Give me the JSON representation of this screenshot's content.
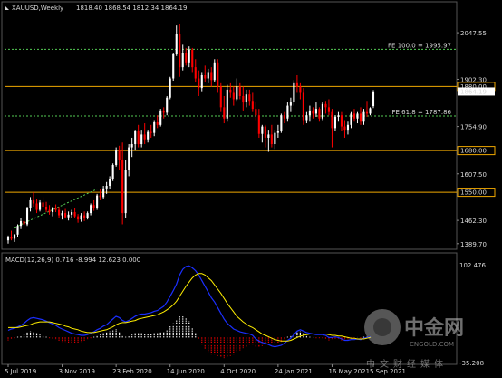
{
  "header": {
    "symbol": "XAUUSD,Weekly",
    "ohlc": "1818.40 1868.54 1812.34 1864.19"
  },
  "macd_header": "MACD(12,26,9) 0.716 -8.994 12.623 0.000",
  "colors": {
    "background": "#000000",
    "bull": "#ffffff",
    "bear": "#ff0000",
    "macd_line": "#1b2fff",
    "signal_line": "#ffee00",
    "hist_pos": "#ffffff",
    "hist_neg": "#ff0000",
    "hline": "#f0a800",
    "fib": "#55cc55",
    "price_box": "#ffffff"
  },
  "watermark": {
    "name": "中金网",
    "domain": "CNGOLD.COM",
    "slogan": "中文财经媒体"
  },
  "chart_data": {
    "type": "candlestick",
    "price_panel": {
      "ylim": [
        1375,
        2110
      ],
      "y_ticks": [
        "2047.55",
        "1902.30",
        "1754.90",
        "1607.50",
        "1462.30",
        "1389.70"
      ],
      "levels": [
        {
          "label": "1880.00",
          "value": 1880,
          "kind": "horizontal"
        },
        {
          "label": "1680.00",
          "value": 1680,
          "kind": "horizontal"
        },
        {
          "label": "1550.00",
          "value": 1550,
          "kind": "horizontal"
        },
        {
          "label": "FE 100.0 = 1995.97",
          "value": 1995.97,
          "kind": "fib"
        },
        {
          "label": "FE 61.8 = 1787.86",
          "value": 1787.86,
          "kind": "fib"
        }
      ],
      "current_price": {
        "label": "1864.19",
        "value": 1864.19
      }
    },
    "macd_panel": {
      "ylim": [
        -35.208,
        102.476
      ],
      "y_ticks": [
        "102.476",
        "-35.208"
      ]
    },
    "x_ticks": [
      "5 Jul 2019",
      "3 Nov 2019",
      "23 Feb 2020",
      "14 Jun 2020",
      "4 Oct 2020",
      "24 Jan 2021",
      "16 May 2021",
      "5 Sep 2021"
    ],
    "candles": [
      [
        1400,
        1415,
        1390,
        1410
      ],
      [
        1410,
        1430,
        1400,
        1405
      ],
      [
        1405,
        1420,
        1395,
        1418
      ],
      [
        1418,
        1450,
        1410,
        1445
      ],
      [
        1445,
        1470,
        1435,
        1460
      ],
      [
        1460,
        1475,
        1440,
        1450
      ],
      [
        1450,
        1505,
        1445,
        1500
      ],
      [
        1500,
        1535,
        1490,
        1525
      ],
      [
        1525,
        1550,
        1505,
        1515
      ],
      [
        1515,
        1530,
        1485,
        1495
      ],
      [
        1495,
        1525,
        1490,
        1518
      ],
      [
        1518,
        1535,
        1500,
        1505
      ],
      [
        1505,
        1520,
        1488,
        1495
      ],
      [
        1495,
        1510,
        1480,
        1488
      ],
      [
        1488,
        1505,
        1475,
        1500
      ],
      [
        1500,
        1512,
        1488,
        1495
      ],
      [
        1495,
        1505,
        1470,
        1478
      ],
      [
        1478,
        1492,
        1465,
        1485
      ],
      [
        1485,
        1498,
        1468,
        1472
      ],
      [
        1472,
        1490,
        1462,
        1480
      ],
      [
        1480,
        1495,
        1470,
        1488
      ],
      [
        1488,
        1500,
        1470,
        1475
      ],
      [
        1475,
        1482,
        1455,
        1465
      ],
      [
        1465,
        1485,
        1458,
        1478
      ],
      [
        1478,
        1490,
        1460,
        1470
      ],
      [
        1470,
        1490,
        1465,
        1485
      ],
      [
        1485,
        1515,
        1478,
        1510
      ],
      [
        1510,
        1525,
        1492,
        1500
      ],
      [
        1500,
        1545,
        1495,
        1540
      ],
      [
        1540,
        1560,
        1525,
        1535
      ],
      [
        1535,
        1570,
        1528,
        1562
      ],
      [
        1562,
        1582,
        1545,
        1570
      ],
      [
        1570,
        1600,
        1560,
        1590
      ],
      [
        1590,
        1640,
        1585,
        1635
      ],
      [
        1635,
        1690,
        1630,
        1680
      ],
      [
        1680,
        1695,
        1620,
        1650
      ],
      [
        1650,
        1705,
        1450,
        1485
      ],
      [
        1485,
        1650,
        1470,
        1620
      ],
      [
        1620,
        1700,
        1600,
        1690
      ],
      [
        1690,
        1720,
        1660,
        1700
      ],
      [
        1700,
        1745,
        1680,
        1740
      ],
      [
        1740,
        1760,
        1690,
        1700
      ],
      [
        1700,
        1745,
        1690,
        1730
      ],
      [
        1730,
        1765,
        1700,
        1715
      ],
      [
        1715,
        1745,
        1705,
        1738
      ],
      [
        1738,
        1760,
        1720,
        1735
      ],
      [
        1735,
        1775,
        1725,
        1768
      ],
      [
        1768,
        1790,
        1750,
        1760
      ],
      [
        1760,
        1810,
        1755,
        1805
      ],
      [
        1805,
        1815,
        1780,
        1798
      ],
      [
        1798,
        1850,
        1790,
        1845
      ],
      [
        1845,
        1910,
        1840,
        1905
      ],
      [
        1905,
        1985,
        1898,
        1980
      ],
      [
        1980,
        2070,
        1975,
        2045
      ],
      [
        2045,
        2075,
        1910,
        1940
      ],
      [
        1940,
        2010,
        1930,
        1985
      ],
      [
        1985,
        2000,
        1945,
        1955
      ],
      [
        1955,
        2005,
        1940,
        1995
      ],
      [
        1995,
        2000,
        1925,
        1940
      ],
      [
        1940,
        1965,
        1895,
        1905
      ],
      [
        1905,
        1930,
        1850,
        1875
      ],
      [
        1875,
        1925,
        1865,
        1915
      ],
      [
        1915,
        1945,
        1895,
        1905
      ],
      [
        1905,
        1935,
        1890,
        1925
      ],
      [
        1925,
        1940,
        1880,
        1900
      ],
      [
        1900,
        1965,
        1895,
        1955
      ],
      [
        1955,
        1965,
        1860,
        1880
      ],
      [
        1880,
        1890,
        1800,
        1815
      ],
      [
        1815,
        1850,
        1765,
        1780
      ],
      [
        1780,
        1885,
        1770,
        1870
      ],
      [
        1870,
        1890,
        1845,
        1860
      ],
      [
        1860,
        1880,
        1820,
        1840
      ],
      [
        1840,
        1905,
        1835,
        1880
      ],
      [
        1880,
        1890,
        1840,
        1850
      ],
      [
        1850,
        1880,
        1805,
        1830
      ],
      [
        1830,
        1870,
        1815,
        1855
      ],
      [
        1855,
        1870,
        1820,
        1835
      ],
      [
        1835,
        1860,
        1800,
        1810
      ],
      [
        1810,
        1830,
        1775,
        1790
      ],
      [
        1790,
        1810,
        1720,
        1732
      ],
      [
        1732,
        1760,
        1705,
        1755
      ],
      [
        1755,
        1760,
        1690,
        1720
      ],
      [
        1720,
        1745,
        1676,
        1730
      ],
      [
        1730,
        1760,
        1690,
        1700
      ],
      [
        1700,
        1745,
        1685,
        1735
      ],
      [
        1735,
        1760,
        1720,
        1740
      ],
      [
        1740,
        1795,
        1735,
        1790
      ],
      [
        1790,
        1800,
        1765,
        1780
      ],
      [
        1780,
        1830,
        1770,
        1820
      ],
      [
        1820,
        1845,
        1800,
        1830
      ],
      [
        1830,
        1900,
        1820,
        1890
      ],
      [
        1890,
        1915,
        1860,
        1880
      ],
      [
        1880,
        1890,
        1840,
        1860
      ],
      [
        1860,
        1875,
        1760,
        1775
      ],
      [
        1775,
        1800,
        1765,
        1790
      ],
      [
        1790,
        1820,
        1770,
        1805
      ],
      [
        1805,
        1815,
        1780,
        1795
      ],
      [
        1795,
        1830,
        1785,
        1810
      ],
      [
        1810,
        1815,
        1770,
        1780
      ],
      [
        1780,
        1830,
        1775,
        1825
      ],
      [
        1825,
        1835,
        1795,
        1815
      ],
      [
        1815,
        1840,
        1790,
        1800
      ],
      [
        1800,
        1810,
        1690,
        1750
      ],
      [
        1750,
        1790,
        1740,
        1785
      ],
      [
        1785,
        1800,
        1770,
        1790
      ],
      [
        1790,
        1800,
        1740,
        1755
      ],
      [
        1755,
        1775,
        1720,
        1745
      ],
      [
        1745,
        1770,
        1730,
        1760
      ],
      [
        1760,
        1800,
        1750,
        1795
      ],
      [
        1795,
        1810,
        1770,
        1780
      ],
      [
        1780,
        1800,
        1765,
        1795
      ],
      [
        1795,
        1815,
        1760,
        1770
      ],
      [
        1770,
        1810,
        1760,
        1800
      ],
      [
        1800,
        1835,
        1785,
        1795
      ],
      [
        1795,
        1815,
        1790,
        1812
      ],
      [
        1818.4,
        1868.54,
        1812.34,
        1864.19
      ]
    ],
    "macd_series": {
      "macd": [
        10,
        12,
        13,
        15,
        17,
        20,
        24,
        27,
        28,
        27,
        26,
        25,
        23,
        21,
        19,
        17,
        14,
        12,
        10,
        8,
        6,
        5,
        4,
        3,
        3,
        4,
        6,
        8,
        11,
        13,
        16,
        18,
        22,
        26,
        30,
        28,
        24,
        22,
        24,
        27,
        30,
        32,
        33,
        33,
        34,
        35,
        37,
        38,
        41,
        44,
        50,
        58,
        66,
        75,
        88,
        96,
        100,
        101,
        98,
        94,
        88,
        80,
        72,
        64,
        56,
        50,
        42,
        34,
        26,
        20,
        16,
        12,
        10,
        8,
        7,
        6,
        5,
        3,
        -2,
        -5,
        -7,
        -8,
        -10,
        -12,
        -13,
        -12,
        -11,
        -8,
        -4,
        -1,
        4,
        9,
        11,
        9,
        7,
        6,
        5,
        4,
        4,
        4,
        3,
        0,
        0,
        1,
        0,
        -2,
        -4,
        -4,
        -3,
        -3,
        -2,
        -3,
        -1,
        0,
        1
      ],
      "signal": [
        14,
        14,
        14,
        14,
        15,
        16,
        17,
        18,
        20,
        21,
        22,
        22,
        22,
        22,
        21,
        20,
        19,
        18,
        16,
        15,
        13,
        12,
        11,
        9,
        8,
        7,
        7,
        7,
        8,
        9,
        10,
        11,
        13,
        15,
        18,
        20,
        21,
        21,
        22,
        23,
        24,
        26,
        27,
        28,
        29,
        30,
        31,
        32,
        34,
        36,
        39,
        42,
        46,
        51,
        58,
        65,
        72,
        78,
        84,
        88,
        90,
        90,
        88,
        84,
        80,
        74,
        68,
        62,
        55,
        48,
        42,
        36,
        30,
        26,
        22,
        19,
        16,
        14,
        11,
        8,
        5,
        3,
        1,
        -1,
        -3,
        -4,
        -5,
        -5,
        -5,
        -4,
        -2,
        0,
        2,
        3,
        4,
        5,
        5,
        5,
        5,
        5,
        5,
        4,
        3,
        3,
        2,
        2,
        1,
        0,
        -1,
        -1,
        -2,
        -2,
        -2,
        -1,
        0
      ]
    }
  }
}
